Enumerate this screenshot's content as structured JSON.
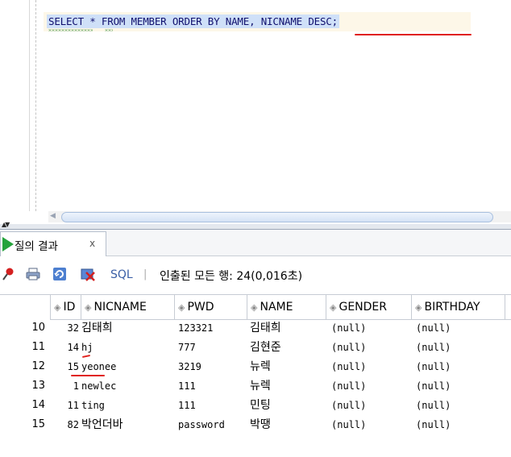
{
  "editor": {
    "sql": "SELECT * FROM MEMBER ORDER BY NAME, NICNAME DESC;"
  },
  "result_tab": {
    "label": "질의 결과",
    "close": "x"
  },
  "toolbar": {
    "sql_label": "SQL",
    "separator": "|",
    "status": "인출된 모든 행: 24(0,016초)"
  },
  "grid": {
    "columns": [
      "ID",
      "NICNAME",
      "PWD",
      "NAME",
      "GENDER",
      "BIRTHDAY"
    ],
    "rows": [
      {
        "num": "10",
        "id": "32",
        "nicname": "김태희",
        "pwd": "123321",
        "name": "김태희",
        "gender": "(null)",
        "birthday": "(null)"
      },
      {
        "num": "11",
        "id": "14",
        "nicname": "hj",
        "pwd": "777",
        "name": "김현준",
        "gender": "(null)",
        "birthday": "(null)"
      },
      {
        "num": "12",
        "id": "15",
        "nicname": "yeonee",
        "pwd": "3219",
        "name": "뉴렉",
        "gender": "(null)",
        "birthday": "(null)"
      },
      {
        "num": "13",
        "id": "1",
        "nicname": "newlec",
        "pwd": "111",
        "name": "뉴렉",
        "gender": "(null)",
        "birthday": "(null)"
      },
      {
        "num": "14",
        "id": "11",
        "nicname": "ting",
        "pwd": "111",
        "name": "민팅",
        "gender": "(null)",
        "birthday": "(null)"
      },
      {
        "num": "15",
        "id": "82",
        "nicname": "박언더바",
        "pwd": "password",
        "name": "박땡",
        "gender": "(null)",
        "birthday": "(null)"
      }
    ]
  },
  "colors": {
    "accent": "#3b5fa6",
    "selection": "#cfe0f8",
    "annotation": "#e0201c",
    "run_icon": "#24a33b"
  }
}
